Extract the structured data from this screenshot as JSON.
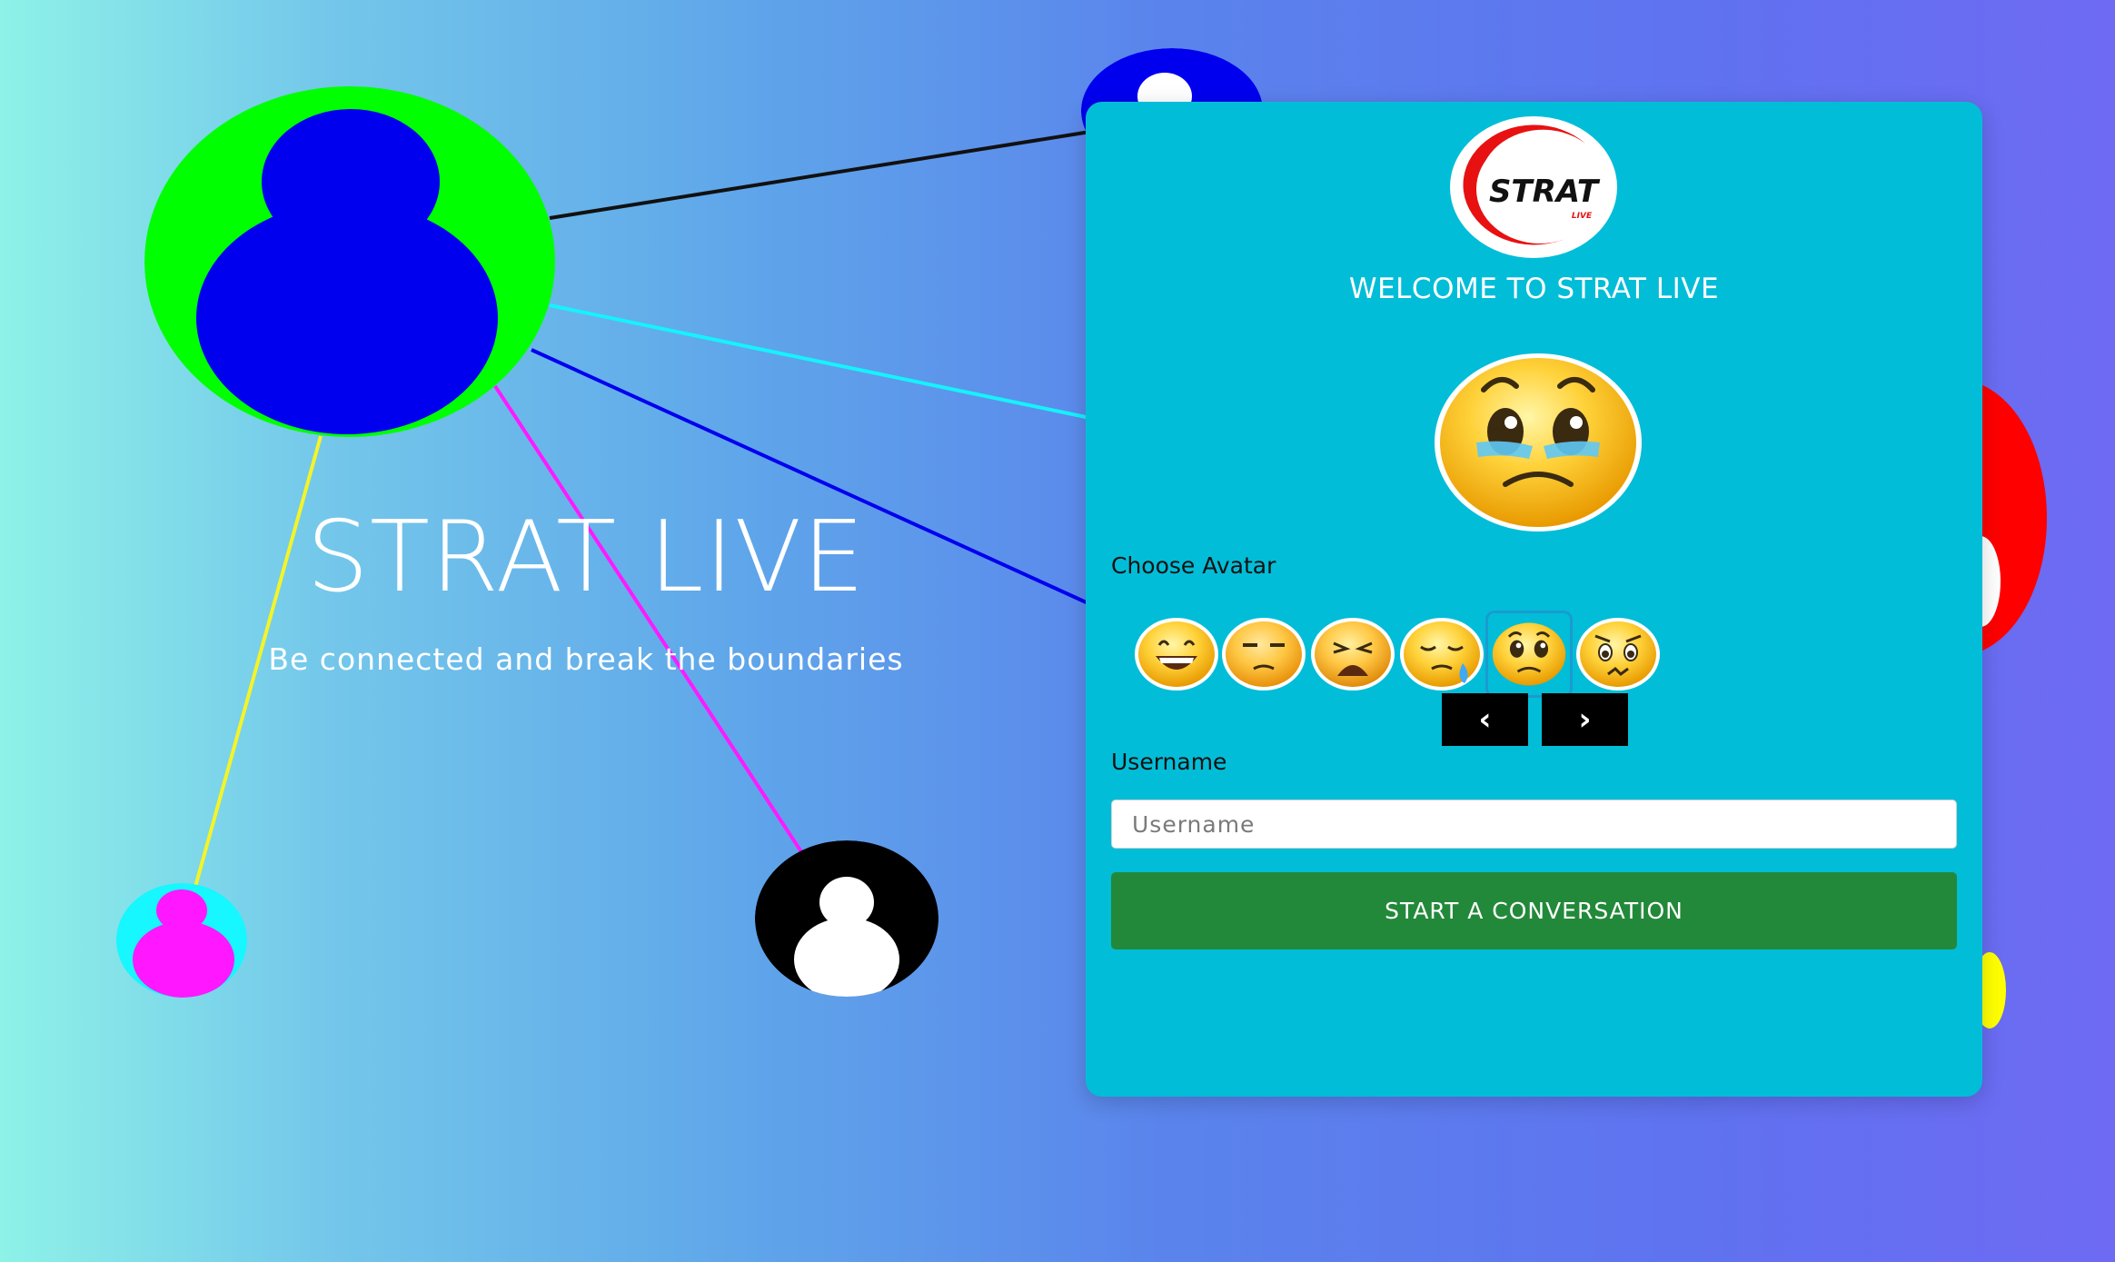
{
  "hero": {
    "title": "STRAT LIVE",
    "subtitle": "Be connected and break the boundaries"
  },
  "card": {
    "logo_text": "STRAT",
    "logo_subtext": "LIVE",
    "welcome": "WELCOME TO STRAT LIVE",
    "choose_avatar_label": "Choose Avatar",
    "avatars": [
      {
        "name": "grinning-face-icon",
        "selected": false
      },
      {
        "name": "unamused-face-icon",
        "selected": false
      },
      {
        "name": "weary-face-icon",
        "selected": false
      },
      {
        "name": "sleepy-face-icon",
        "selected": false
      },
      {
        "name": "pleading-face-icon",
        "selected": true
      },
      {
        "name": "worried-face-icon",
        "selected": false
      }
    ],
    "prev_label": "‹",
    "next_label": "›",
    "username_label": "Username",
    "username_placeholder": "Username",
    "username_value": "",
    "start_button": "START A CONVERSATION"
  },
  "colors": {
    "card": "#02bdd8",
    "start_button": "#23893a",
    "nav_button": "#000000"
  }
}
